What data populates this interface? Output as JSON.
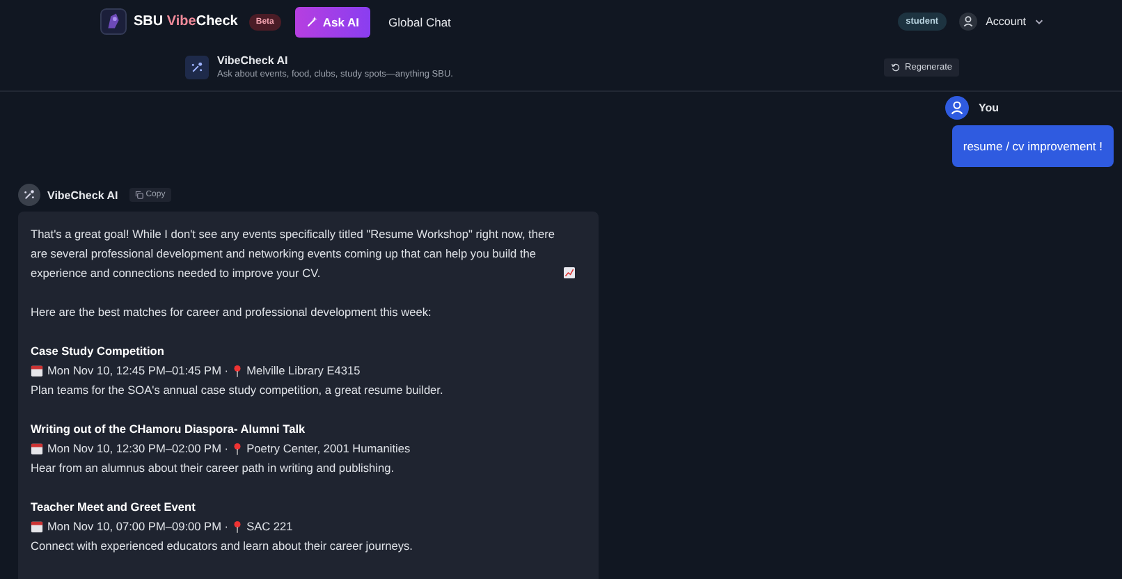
{
  "header": {
    "brand": {
      "start": "SBU ",
      "accent": "Vibe",
      "end": "Check"
    },
    "badge": "Beta",
    "nav": [
      {
        "label": "Ask AI",
        "selected": true
      },
      {
        "label": "Global Chat",
        "selected": false
      }
    ],
    "role": "student",
    "account": "Account"
  },
  "assistant_bar": {
    "title": "VibeCheck AI",
    "subtitle": "Ask about events, food, clubs, study spots—anything SBU.",
    "action": "Regenerate"
  },
  "user_message": {
    "author": "You",
    "text": "resume / cv improvement !"
  },
  "ai_message": {
    "author": "VibeCheck AI",
    "copy": "Copy",
    "intro": "That's a great goal! While I don't see any events specifically titled \"Resume Workshop\" right now, there are several professional development and networking events coming up that can help you build the experience and connections needed to improve your CV.",
    "lead": "Here are the best matches for career and professional development this week:",
    "events": [
      {
        "title": "Case Study Competition",
        "when": "Mon Nov 10, 12:45 PM–01:45 PM ·",
        "place": "Melville Library E4315",
        "description": "Plan teams for the SOA's annual case study competition, a great resume builder."
      },
      {
        "title": "Writing out of the CHamoru Diaspora- Alumni Talk",
        "when": "Mon Nov 10, 12:30 PM–02:00 PM ·",
        "place": "Poetry Center, 2001 Humanities",
        "description": "Hear from an alumnus about their career path in writing and publishing."
      },
      {
        "title": "Teacher Meet and Greet Event",
        "when": "Mon Nov 10, 07:00 PM–09:00 PM ·",
        "place": "SAC 221",
        "description": "Connect with experienced educators and learn about their career journeys."
      }
    ]
  }
}
